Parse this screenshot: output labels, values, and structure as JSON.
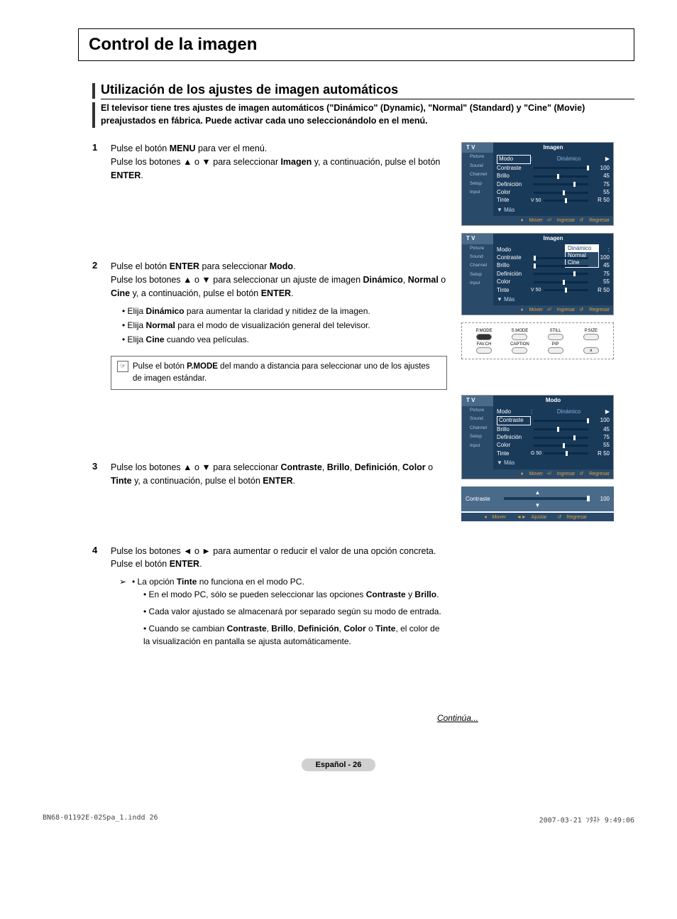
{
  "pageTitle": "Control de la imagen",
  "sectionTitle": "Utilización de los ajustes de imagen automáticos",
  "intro": "El televisor tiene tres ajustes de imagen automáticos (\"Dinámico\" (Dynamic), \"Normal\" (Standard) y \"Cine\" (Movie) preajustados en fábrica. Puede activar cada uno seleccionándolo en el menú.",
  "steps": {
    "s1": {
      "num": "1",
      "line1": "Pulse el botón ",
      "menu": "MENU",
      "line1b": " para ver el menú.",
      "line2a": "Pulse los botones ▲ o ▼ para seleccionar ",
      "imagen": "Imagen",
      "line2b": " y, a continuación, pulse el botón ",
      "enter": "ENTER",
      "line2c": "."
    },
    "s2": {
      "num": "2",
      "line1a": "Pulse el botón ",
      "enter": "ENTER",
      "line1b": " para seleccionar ",
      "modo": "Modo",
      "line1c": ".",
      "line2a": "Pulse los botones ▲ o ▼ para seleccionar un ajuste de imagen ",
      "dinamico": "Dinámico",
      "line2b": ", ",
      "normal": "Normal",
      "line2c": " o ",
      "cine": "Cine",
      "line2d": " y, a continuación, pulse el botón ",
      "enter2": "ENTER",
      "line2e": ".",
      "b1a": "• Elija ",
      "b1b": "Dinámico",
      "b1c": " para aumentar la claridad y nitidez de la imagen.",
      "b2a": "• Elija ",
      "b2b": "Normal",
      "b2c": " para el modo de visualización general del televisor.",
      "b3a": "• Elija ",
      "b3b": "Cine",
      "b3c": " cuando vea películas.",
      "noteA": "Pulse el botón ",
      "noteB": "P.MODE",
      "noteC": " del mando a distancia para seleccionar uno de los ajustes de imagen estándar."
    },
    "s3": {
      "num": "3",
      "a": "Pulse los botones ▲ o ▼ para seleccionar ",
      "contraste": "Contraste",
      "c": ", ",
      "brillo": "Brillo",
      "c2": ", ",
      "def": "Definición",
      "c3": ", ",
      "color": "Color",
      "c4": " o ",
      "tinte": "Tinte",
      "b": " y, a continuación, pulse el botón ",
      "enter": "ENTER",
      "d": "."
    },
    "s4": {
      "num": "4",
      "a": "Pulse los botones ◄ o ► para aumentar o reducir el valor de una opción concreta. Pulse el botón ",
      "enter": "ENTER",
      "b": ".",
      "sub1a": "• La opción ",
      "sub1b": "Tinte",
      "sub1c": " no funciona en el modo PC.",
      "sub2a": "• En el modo PC, sólo se pueden seleccionar las opciones ",
      "sub2b": "Contraste",
      "sub2c": " y ",
      "sub2d": "Brillo",
      "sub2e": ".",
      "sub3": "• Cada valor ajustado se almacenará por separado según su modo de entrada.",
      "sub4a": "• Cuando se cambian ",
      "sub4b": "Contraste",
      "sub4c": ", ",
      "sub4d": "Brillo",
      "sub4e": ", ",
      "sub4f": "Definición",
      "sub4g": ", ",
      "sub4h": "Color",
      "sub4i": " o ",
      "sub4j": "Tinte",
      "sub4k": ", el color de la visualización en pantalla se ajusta automáticamente."
    }
  },
  "osd": {
    "tv": "T V",
    "imagen": "Imagen",
    "modoTitle": "Modo",
    "side": {
      "picture": "Picture",
      "sound": "Sound",
      "channel": "Channel",
      "setup": "Setup",
      "input": "Input"
    },
    "rows": {
      "modo": "Modo",
      "dinamico": "Dinámico",
      "normal": "Normal",
      "cine": "Cine",
      "contraste": "Contraste",
      "brillo": "Brillo",
      "definicion": "Definición",
      "color": "Color",
      "tinte": "Tinte"
    },
    "vals": {
      "v100": "100",
      "v45": "45",
      "v75": "75",
      "v55": "55",
      "v50l": "V 50",
      "v50r": "R 50",
      "g50": "G 50"
    },
    "mas": "▼ Más",
    "foot": {
      "mover": "Mover",
      "ingresar": "Ingresar",
      "regresar": "Regresar",
      "ajustar": "Ajustar"
    }
  },
  "remote": {
    "pmode": "P.MODE",
    "smode": "S.MODE",
    "still": "STILL",
    "psize": "P.SIZE",
    "favch": "FAV.CH",
    "caption": "CAPTION",
    "pip": "PIP"
  },
  "slider": {
    "label": "Contraste",
    "val": "100"
  },
  "continua": "Continúa...",
  "pageNum": "Español - 26",
  "footer": {
    "left": "BN68-01192E-02Spa_1.indd   26",
    "right": "2007-03-21   ｿﾀﾈﾄ 9:49:06"
  },
  "arrowMark": "➢"
}
